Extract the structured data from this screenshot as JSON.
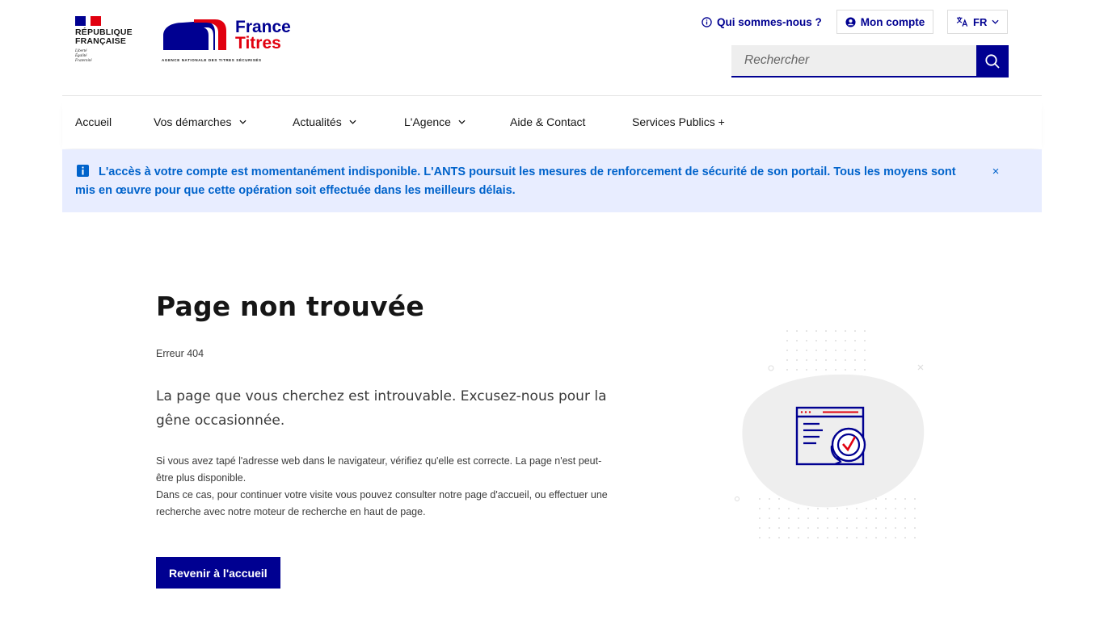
{
  "header": {
    "republic_name": "RÉPUBLIQUE\nFRANÇAISE",
    "motto": "Liberté\nÉgalité\nFraternité",
    "brand_line1": "France",
    "brand_line2": "Titres",
    "agency_name": "AGENCE NATIONALE DES TITRES SÉCURISÉS",
    "about_link": "Qui sommes-nous ?",
    "account_button": "Mon compte",
    "language": "FR",
    "search_placeholder": "Rechercher"
  },
  "nav": {
    "items": [
      {
        "label": "Accueil"
      },
      {
        "label": "Vos démarches"
      },
      {
        "label": "Actualités"
      },
      {
        "label": "L'Agence"
      },
      {
        "label": "Aide & Contact"
      },
      {
        "label": "Services Publics +"
      }
    ]
  },
  "notice": {
    "message": "L'accès à votre compte est momentanément indisponible. L'ANTS poursuit les mesures de renforcement de sécurité de son portail. Tous les moyens sont mis en œuvre pour que cette opération soit effectuée dans les meilleurs délais.",
    "close": "×"
  },
  "main": {
    "title": "Page non trouvée",
    "error_code": "Erreur 404",
    "lead": "La page que vous cherchez est introuvable. Excusez-nous pour la gêne occasionnée.",
    "paragraph1": "Si vous avez tapé l'adresse web dans le navigateur, vérifiez qu'elle est correcte. La page n'est peut-être plus disponible.",
    "paragraph2": "Dans ce cas, pour continuer votre visite vous pouvez consulter notre page d'accueil, ou effectuer une recherche avec notre moteur de recherche en haut de page.",
    "home_button": "Revenir à l'accueil"
  },
  "colors": {
    "blue_france": "#000091",
    "red_marianne": "#e1000f",
    "info_blue": "#0063cb",
    "notice_bg": "#e8edff"
  }
}
